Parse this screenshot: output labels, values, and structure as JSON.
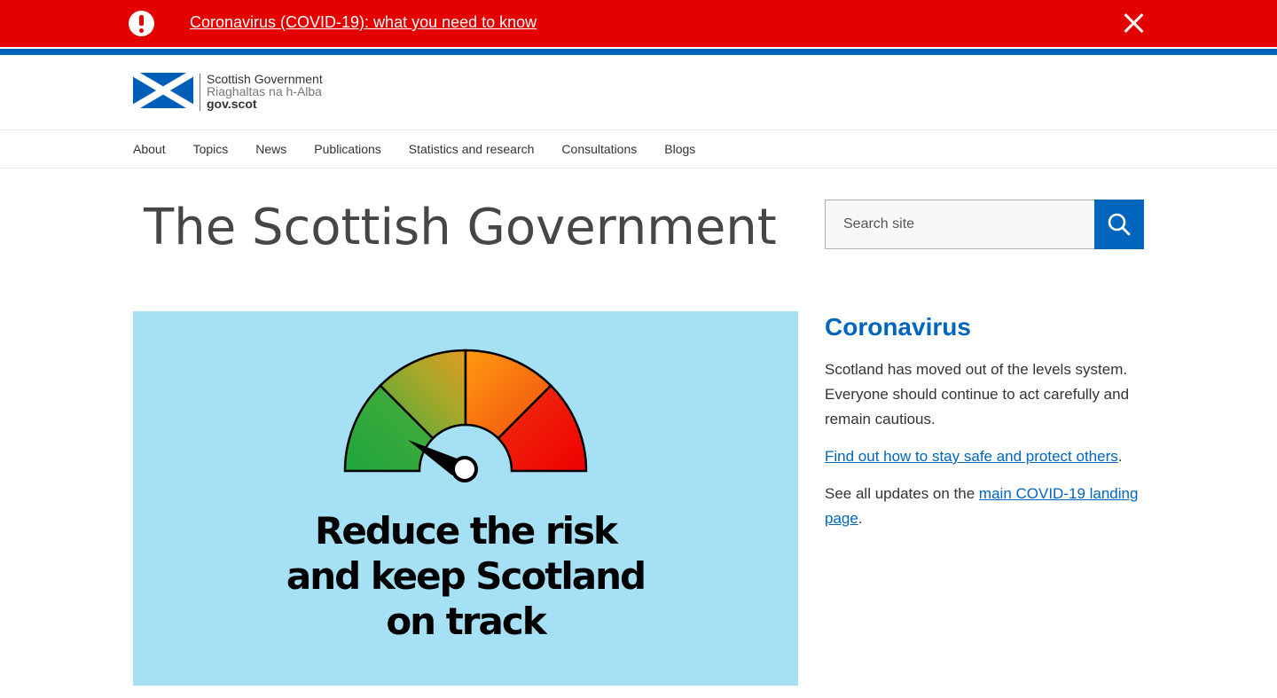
{
  "alert": {
    "icon": "exclamation-icon",
    "link_text": "Coronavirus (COVID-19): what you need to know",
    "close_icon": "close-icon"
  },
  "colors": {
    "alert_red": "#e50000",
    "brand_blue": "#0065bd",
    "hero_bg": "#a6e0f5"
  },
  "logo": {
    "line1": "Scottish Government",
    "line2": "Riaghaltas na h-Alba",
    "line3": "gov.scot"
  },
  "nav": {
    "items": [
      {
        "label": "About"
      },
      {
        "label": "Topics"
      },
      {
        "label": "News"
      },
      {
        "label": "Publications"
      },
      {
        "label": "Statistics and research"
      },
      {
        "label": "Consultations"
      },
      {
        "label": "Blogs"
      }
    ]
  },
  "page": {
    "title": "The Scottish Government"
  },
  "search": {
    "placeholder": "Search site",
    "button_icon": "search-icon"
  },
  "hero": {
    "line1": "Reduce the risk",
    "line2": "and keep Scotland",
    "line3": "on track"
  },
  "covid": {
    "heading": "Coronavirus",
    "body": "Scotland has moved out of the levels system. Everyone should continue to act carefully and remain cautious.",
    "link1": "Find out how to stay safe and protect others",
    "link1_suffix": ".",
    "p3_prefix": "See all updates on the ",
    "link2": "main COVID-19 landing page",
    "p3_suffix": "."
  }
}
